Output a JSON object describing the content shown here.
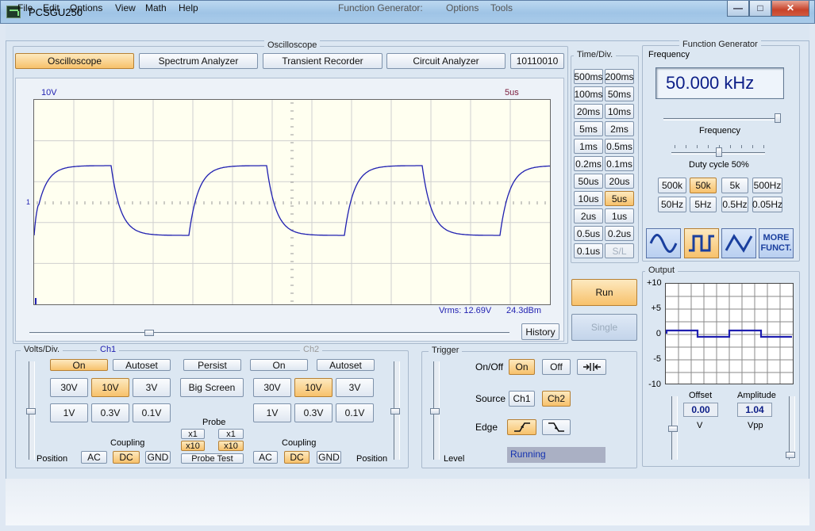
{
  "window": {
    "title": "PCSGU250"
  },
  "menu": {
    "left": [
      "File",
      "Edit",
      "Options",
      "View",
      "Math",
      "Help"
    ],
    "right": [
      "Function Generator:",
      "Options",
      "Tools"
    ]
  },
  "osc": {
    "group_title": "Oscilloscope",
    "tabs": [
      "Oscilloscope",
      "Spectrum Analyzer",
      "Transient Recorder",
      "Circuit Analyzer",
      "10110010"
    ],
    "volts_label": "10V",
    "time_label": "5us",
    "marker": "1",
    "vrms": "Vrms: 12.69V",
    "dbm": "24.3dBm",
    "history": "History",
    "trace_color": "#1f1fb0"
  },
  "timediv": {
    "title": "Time/Div.",
    "buttons": [
      [
        "500ms",
        "200ms"
      ],
      [
        "100ms",
        "50ms"
      ],
      [
        "20ms",
        "10ms"
      ],
      [
        "5ms",
        "2ms"
      ],
      [
        "1ms",
        "0.5ms"
      ],
      [
        "0.2ms",
        "0.1ms"
      ],
      [
        "50us",
        "20us"
      ],
      [
        "10us",
        "5us"
      ],
      [
        "2us",
        "1us"
      ],
      [
        "0.5us",
        "0.2us"
      ],
      [
        "0.1us",
        "S/L"
      ]
    ],
    "selected": "5us",
    "run": "Run",
    "single": "Single"
  },
  "fg": {
    "title": "Function Generator",
    "freq_title": "Frequency",
    "display": "50.000 kHz",
    "slider_label": "Frequency",
    "duty": "Duty cycle 50%",
    "range_buttons": [
      [
        "500k",
        "50k",
        "5k",
        "500Hz"
      ],
      [
        "50Hz",
        "5Hz",
        "0.5Hz",
        "0.05Hz"
      ]
    ],
    "range_selected": "50k",
    "more": "MORE FUNCT.",
    "output_title": "Output",
    "y_ticks": [
      "+10",
      "+5",
      "0",
      "-5",
      "-10"
    ],
    "offset_label": "Offset",
    "offset_value": "0.00",
    "offset_unit": "V",
    "amp_label": "Amplitude",
    "amp_value": "1.04",
    "amp_unit": "Vpp"
  },
  "volts": {
    "title": "Volts/Div.",
    "ch1": "Ch1",
    "ch2": "Ch2",
    "on": "On",
    "autoset": "Autoset",
    "persist": "Persist",
    "big_screen": "Big Screen",
    "buttons": [
      [
        "30V",
        "10V",
        "3V"
      ],
      [
        "1V",
        "0.3V",
        "0.1V"
      ]
    ],
    "selected": "10V",
    "probe": "Probe",
    "x1": "x1",
    "x10": "x10",
    "probe_test": "Probe Test",
    "coupling": "Coupling",
    "ac": "AC",
    "dc": "DC",
    "gnd": "GND",
    "position": "Position"
  },
  "trigger": {
    "title": "Trigger",
    "onoff": "On/Off",
    "on": "On",
    "off": "Off",
    "source": "Source",
    "ch1": "Ch1",
    "ch2": "Ch2",
    "edge": "Edge",
    "level": "Level",
    "status": "Running"
  }
}
